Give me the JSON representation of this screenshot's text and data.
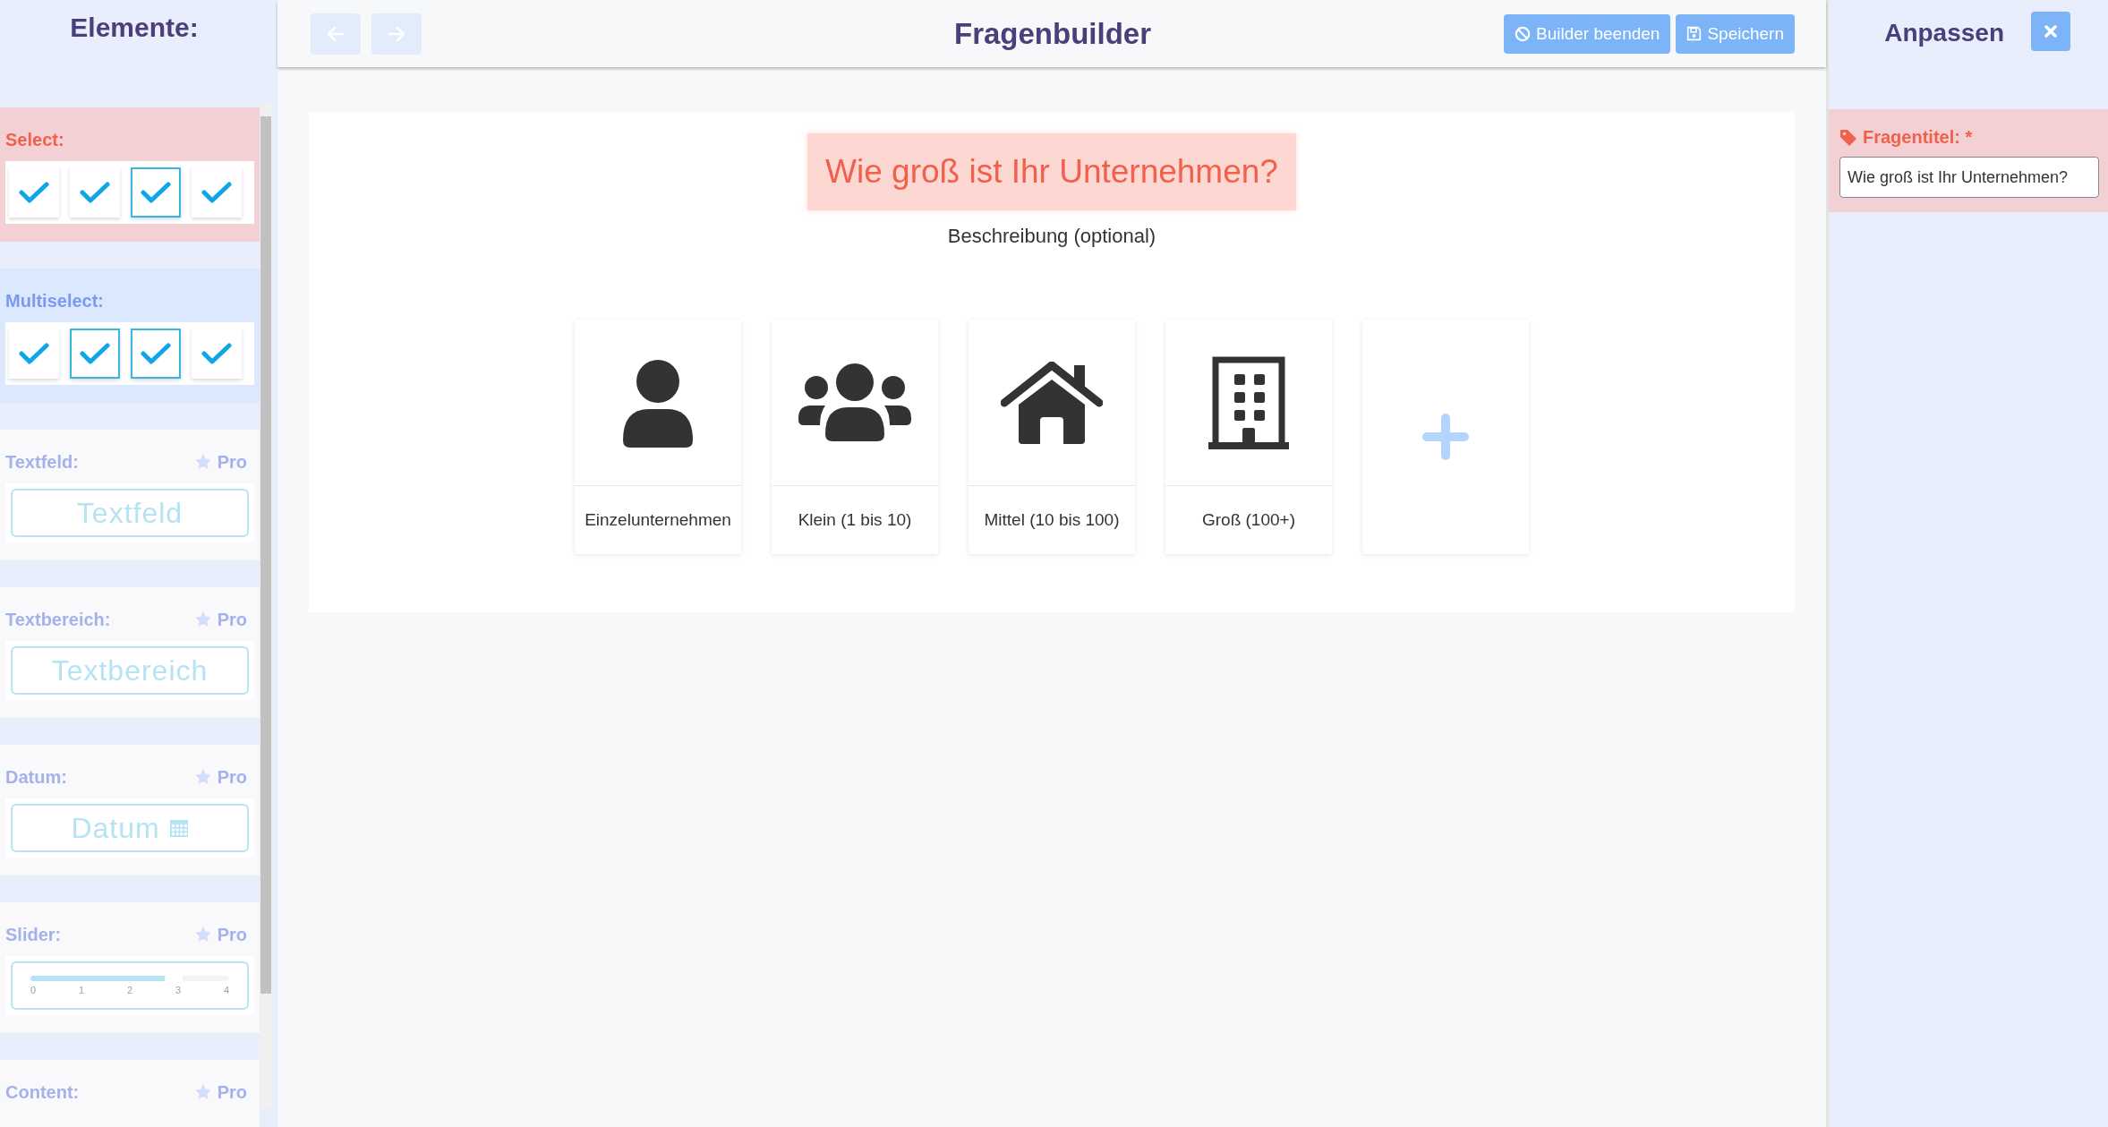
{
  "sidebar": {
    "title": "Elemente:",
    "sections": [
      {
        "kind": "select",
        "label": "Select:",
        "options": [
          {
            "selected": false
          },
          {
            "selected": false
          },
          {
            "selected": true
          },
          {
            "selected": false
          }
        ]
      },
      {
        "kind": "multiselect",
        "label": "Multiselect:",
        "options": [
          {
            "selected": false
          },
          {
            "selected": true
          },
          {
            "selected": true
          },
          {
            "selected": false
          }
        ]
      },
      {
        "kind": "textfield",
        "label": "Textfeld:",
        "badge": "Pro",
        "preview": "Textfeld"
      },
      {
        "kind": "textarea",
        "label": "Textbereich:",
        "badge": "Pro",
        "preview": "Textbereich"
      },
      {
        "kind": "date",
        "label": "Datum:",
        "badge": "Pro",
        "preview": "Datum"
      },
      {
        "kind": "slider",
        "label": "Slider:",
        "badge": "Pro",
        "level": 0.72,
        "ticks": [
          "0",
          "1",
          "2",
          "3",
          "4"
        ]
      },
      {
        "kind": "content",
        "label": "Content:",
        "badge": "Pro"
      }
    ]
  },
  "toolbar": {
    "nav": [
      {
        "kind": "back",
        "disabled": true
      },
      {
        "kind": "forward",
        "disabled": true
      }
    ],
    "title": "Fragenbuilder",
    "buttons": [
      {
        "kind": "end",
        "label": "Builder beenden"
      },
      {
        "kind": "save",
        "label": "Speichern"
      }
    ]
  },
  "question": {
    "title": "Wie groß ist Ihr Unternehmen?",
    "description": "Beschreibung (optional)",
    "answers": [
      {
        "kind": "person",
        "label": "Einzelunternehmen"
      },
      {
        "kind": "group",
        "label": "Klein (1 bis 10)"
      },
      {
        "kind": "house",
        "label": "Mittel (10 bis 100)"
      },
      {
        "kind": "building",
        "label": "Groß (100+)"
      },
      {
        "kind": "add"
      }
    ]
  },
  "panel": {
    "title": "Anpassen",
    "field": {
      "label": "Fragentitel: *",
      "value": "Wie groß ist Ihr Unternehmen?"
    }
  }
}
